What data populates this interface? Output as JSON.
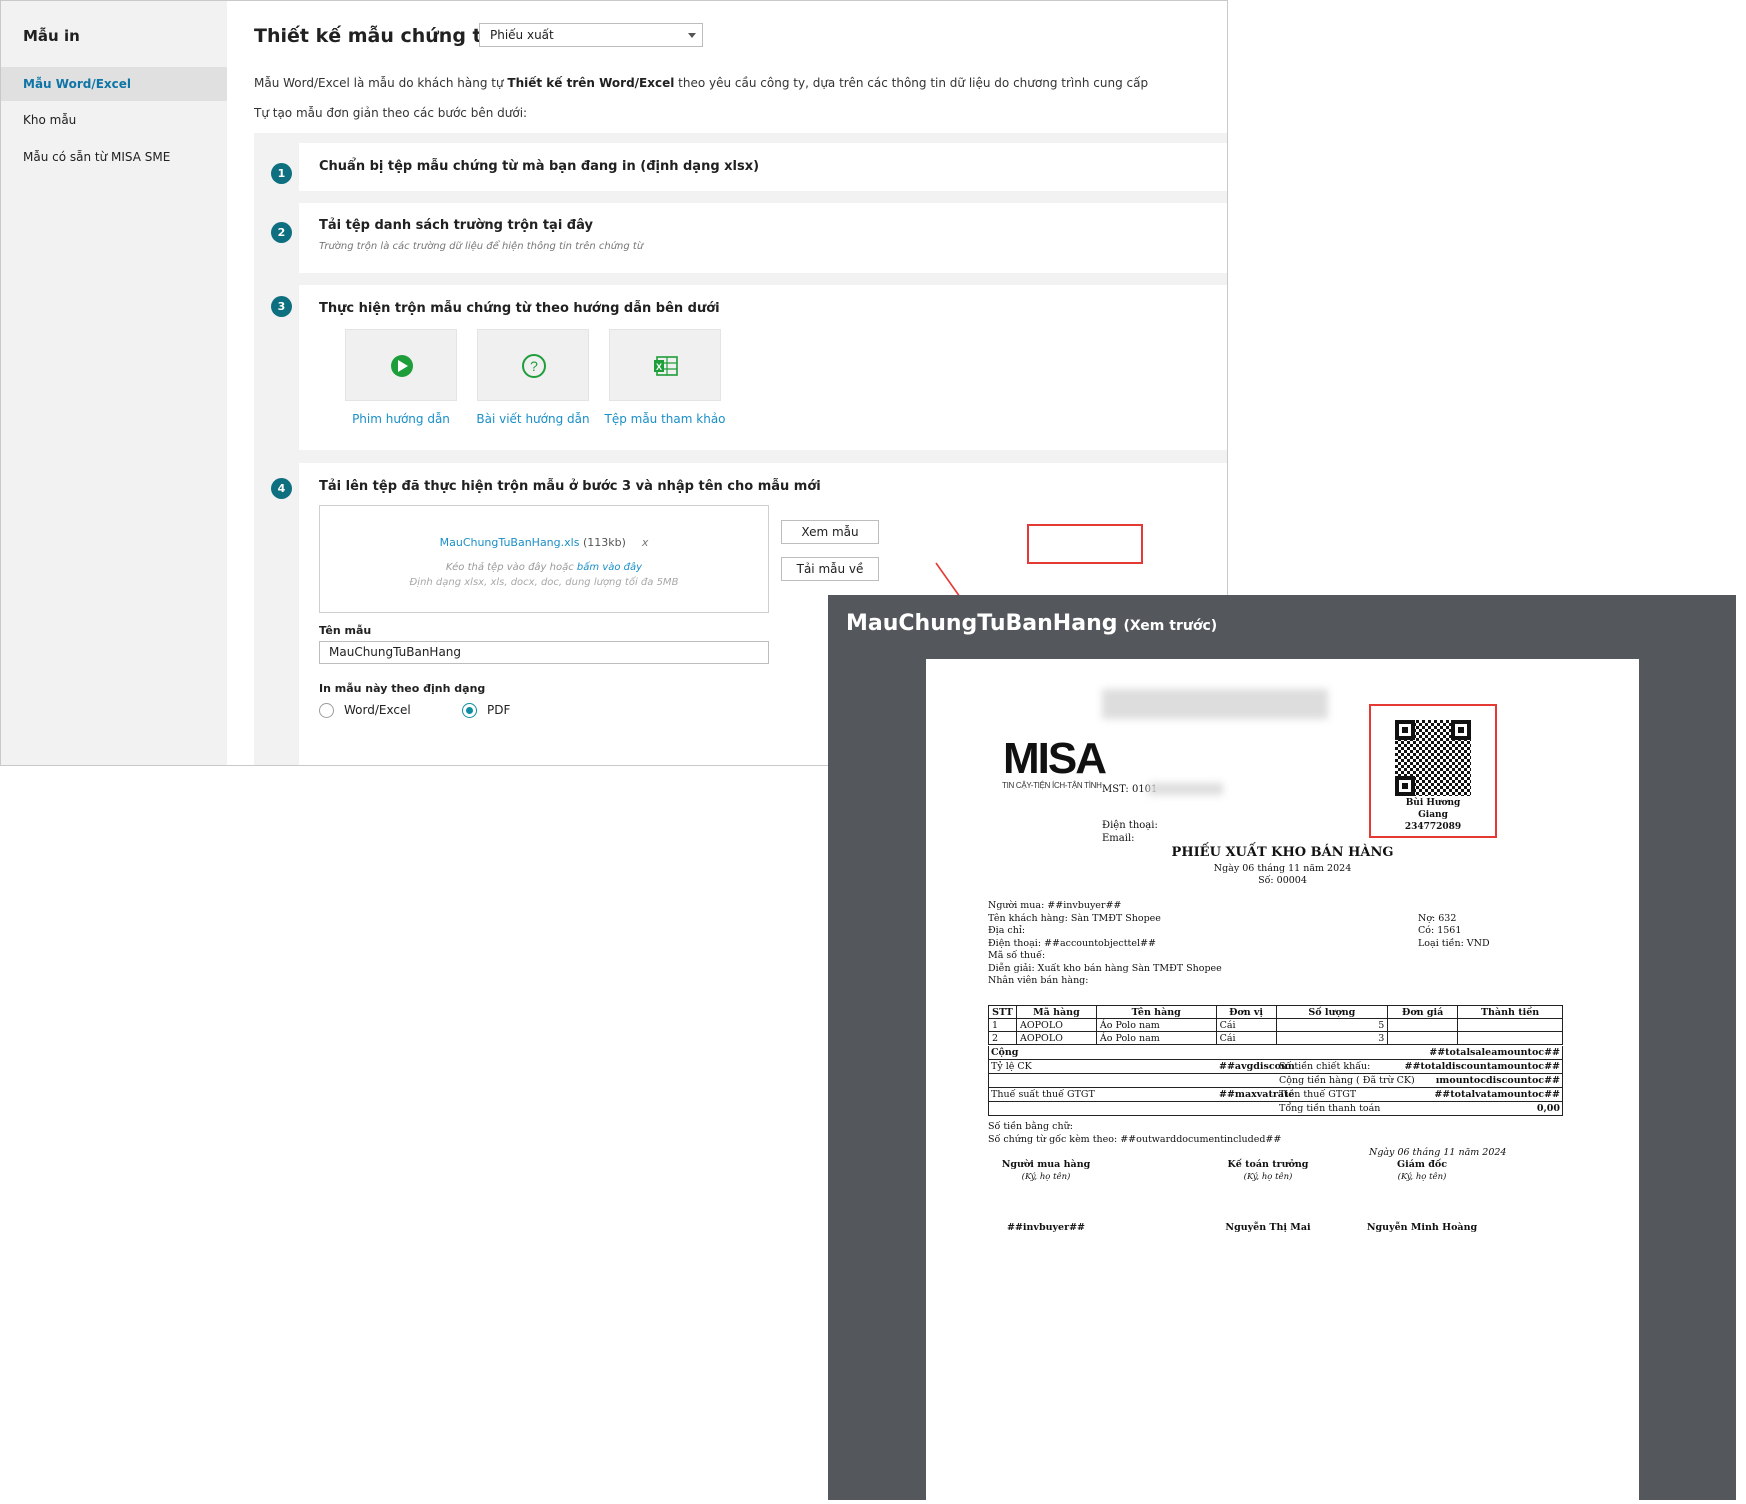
{
  "sidebar": {
    "title": "Mẫu in",
    "items": [
      {
        "label": "Mẫu Word/Excel",
        "active": true
      },
      {
        "label": "Kho mẫu",
        "active": false
      },
      {
        "label": "Mẫu có sẵn từ MISA SME",
        "active": false
      }
    ]
  },
  "header": {
    "title": "Thiết kế mẫu chứng từ",
    "select_value": "Phiếu xuất"
  },
  "intro": {
    "line1_pre": "Mẫu Word/Excel là mẫu do khách hàng tự ",
    "line1_bold": "Thiết kế trên Word/Excel",
    "line1_post": " theo yêu cầu công ty, dựa trên các thông tin dữ liệu do chương trình cung cấp",
    "line2": "Tự tạo mẫu đơn giản theo các bước bên dưới:"
  },
  "steps": [
    {
      "num": "1",
      "title": "Chuẩn bị tệp mẫu chứng từ mà bạn đang in (định dạng xlsx)"
    },
    {
      "num": "2",
      "title": "Tải tệp danh sách trường trộn tại đây",
      "subtitle": "Trường trộn là các trường dữ liệu để hiện thông tin trên chứng từ"
    },
    {
      "num": "3",
      "title": "Thực hiện trộn mẫu chứng từ theo hướng dẫn bên dưới",
      "tiles": [
        {
          "label": "Phim hướng dẫn",
          "icon": "play-icon"
        },
        {
          "label": "Bài viết hướng dẫn",
          "icon": "help-icon"
        },
        {
          "label": "Tệp mẫu tham khảo",
          "icon": "excel-icon"
        }
      ]
    },
    {
      "num": "4",
      "title": "Tải lên tệp đã thực hiện trộn mẫu ở bước 3 và nhập tên cho mẫu mới"
    }
  ],
  "upload": {
    "file_name": "MauChungTuBanHang.xls",
    "file_size": "(113kb)",
    "remove": "x",
    "hint_pre": "Kéo thả tệp vào đây hoặc ",
    "hint_link": "bấm vào đây",
    "formats": "Định dạng xlsx, xls, docx, doc, dung lượng tối đa 5MB",
    "preview_button": "Xem mẫu",
    "download_button": "Tải mẫu về"
  },
  "form": {
    "name_label": "Tên mẫu",
    "name_value": "MauChungTuBanHang",
    "format_label": "In mẫu này theo định dạng",
    "options": [
      {
        "label": "Word/Excel",
        "selected": false
      },
      {
        "label": "PDF",
        "selected": true
      }
    ]
  },
  "preview": {
    "title": "MauChungTuBanHang",
    "subtitle": "(Xem trước)"
  },
  "doc": {
    "logo": "MISA",
    "logo_tagline": "TIN CẬY-TIỆN ÍCH-TẬN TÌNH",
    "mst": "MST: 0101",
    "phone": "Điện thoại:",
    "email": "Email:",
    "signer_name_1": "Bùi Hương",
    "signer_name_2": "Giang",
    "signer_code": "234772089",
    "title": "PHIẾU XUẤT KHO BÁN HÀNG",
    "date": "Ngày 06 tháng 11 năm 2024",
    "number": "Số: 00004",
    "buyer": "Người mua: ##invbuyer##",
    "customer": "Tên khách hàng: Sàn TMĐT Shopee",
    "address": "Địa chỉ:",
    "tel": "Điện thoại: ##accountobjecttel##",
    "tax": "Mã số thuế:",
    "note": "Diễn giải: Xuất kho bán hàng Sàn TMĐT Shopee",
    "staff": "Nhân viên bán hàng:",
    "debit": "Nợ: 632",
    "credit": "Có: 1561",
    "currency": "Loại tiền: VND",
    "columns": [
      "STT",
      "Mã hàng",
      "Tên hàng",
      "Đơn vị",
      "Số lượng",
      "Đơn giá",
      "Thành tiền"
    ],
    "rows": [
      [
        "1",
        "AOPOLO",
        "Áo Polo nam",
        "Cái",
        "5",
        "",
        ""
      ],
      [
        "2",
        "AOPOLO",
        "Áo Polo nam",
        "Cái",
        "3",
        "",
        ""
      ]
    ],
    "total_label": "Cộng",
    "total_value": "##totalsaleamountoc##",
    "discount_rate_label": "Tỷ lệ CK",
    "discount_rate_value": "##avgdiscoun",
    "discount_amount_label": "Số tiền chiết khấu:",
    "discount_amount_value": "##totaldiscountamountoc##",
    "goods_total_label": "Cộng tiền hàng ( Đã trừ CK)",
    "goods_total_value": "ımountocdiscountoc##",
    "vat_rate_label": "Thuế suất thuế GTGT",
    "vat_rate_value": "##maxvatrate",
    "vat_amount_label": "Tiền thuế GTGT",
    "vat_amount_value": "##totalvatamountoc##",
    "grand_total_label": "Tổng tiền thanh toán",
    "grand_total_value": "0,00",
    "in_words": "Số tiền bằng chữ:",
    "attached": "Số chứng từ gốc kèm theo: ##outwarddocumentincluded##",
    "sign_date": "Ngày 06 tháng 11 năm 2024",
    "signers": [
      {
        "role": "Người mua hàng",
        "hint": "(Ký, họ tên)",
        "name": "##invbuyer##"
      },
      {
        "role": "Kế toán trưởng",
        "hint": "(Ký, họ tên)",
        "name": "Nguyễn Thị Mai"
      },
      {
        "role": "Giám đốc",
        "hint": "(Ký, họ tên)",
        "name": "Nguyễn Minh Hoàng"
      }
    ]
  },
  "colors": {
    "accent_teal": "#0d6f7f",
    "link_blue": "#1a8fc7",
    "highlight_red": "#e53935",
    "preview_bg": "#54585c",
    "play_green": "#1e9e3a"
  }
}
